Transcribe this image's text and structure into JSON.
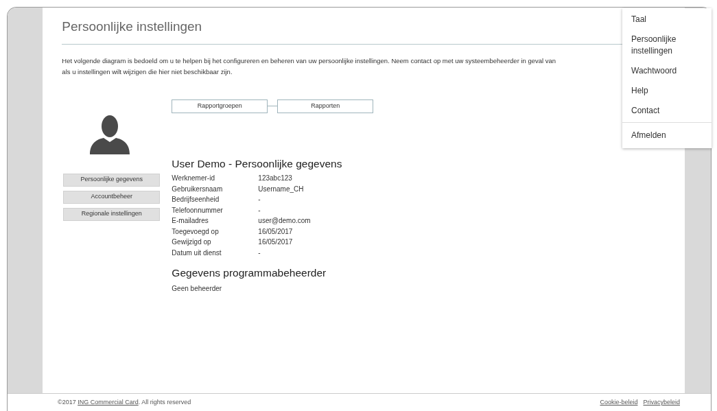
{
  "page_title": "Persoonlijke instellingen",
  "intro_lines": [
    "Het volgende diagram is bedoeld om u te helpen bij het configureren en beheren van uw persoonlijke instellingen. Neem contact op met uw systeembeheerder in geval van",
    "als u instellingen wilt wijzigen die hier niet beschikbaar zijn."
  ],
  "diagram": [
    "Rapportgroepen",
    "Rapporten"
  ],
  "side_nav": [
    "Persoonlijke gegevens",
    "Accountbeheer",
    "Regionale instellingen"
  ],
  "details": {
    "title": "User Demo - Persoonlijke gegevens",
    "rows": [
      {
        "label": "Werknemer-id",
        "value": "123abc123"
      },
      {
        "label": "Gebruikersnaam",
        "value": "Username_CH"
      },
      {
        "label": "Bedrijfseenheid",
        "value": "-"
      },
      {
        "label": "Telefoonnummer",
        "value": "-"
      },
      {
        "label": "E-mailadres",
        "value": "user@demo.com"
      },
      {
        "label": "Toegevoegd op",
        "value": "16/05/2017"
      },
      {
        "label": "Gewijzigd op",
        "value": "16/05/2017"
      },
      {
        "label": "Datum uit dienst",
        "value": "-"
      }
    ]
  },
  "manager": {
    "title": "Gegevens programmabeheerder",
    "text": "Geen beheerder"
  },
  "footer": {
    "prefix": "©2017",
    "link": "ING Commercial Card",
    "suffix": ". All rights reserved",
    "links": [
      "Cookie-beleid",
      "Privacybeleid"
    ]
  },
  "menu": {
    "groups": [
      [
        "Taal",
        "Persoonlijke instellingen",
        "Wachtwoord",
        "Help",
        "Contact"
      ],
      [
        "Afmelden"
      ]
    ]
  }
}
